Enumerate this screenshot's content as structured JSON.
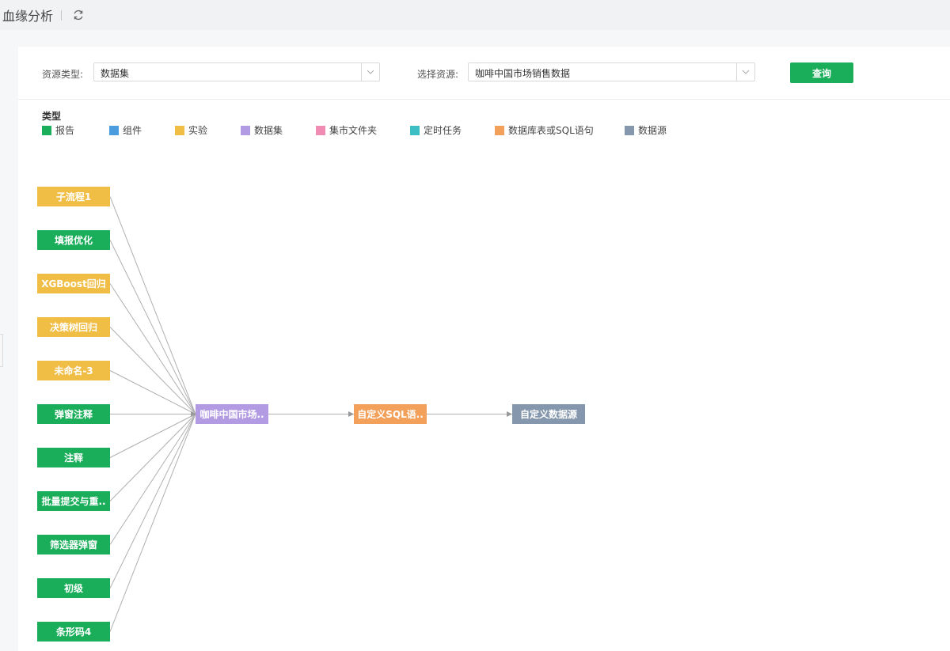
{
  "header": {
    "title": "血缘分析"
  },
  "filters": {
    "resource_type_label": "资源类型:",
    "resource_type_value": "数据集",
    "select_resource_label": "选择资源:",
    "select_resource_value": "咖啡中国市场销售数据",
    "query_label": "查询"
  },
  "legend": {
    "title": "类型",
    "items": [
      {
        "label": "报告",
        "color": "#1aad5a"
      },
      {
        "label": "组件",
        "color": "#4a9ee0"
      },
      {
        "label": "实验",
        "color": "#f0bd45"
      },
      {
        "label": "数据集",
        "color": "#b39be3"
      },
      {
        "label": "集市文件夹",
        "color": "#f08cb4"
      },
      {
        "label": "定时任务",
        "color": "#3dbdc4"
      },
      {
        "label": "数据库表或SQL语句",
        "color": "#f2a05a"
      },
      {
        "label": "数据源",
        "color": "#8497ad"
      }
    ]
  },
  "graph": {
    "left_nodes": [
      {
        "label": "子流程1",
        "color": "#f0bd45"
      },
      {
        "label": "填报优化",
        "color": "#1aad5a"
      },
      {
        "label": "XGBoost回归",
        "color": "#f0bd45"
      },
      {
        "label": "决策树回归",
        "color": "#f0bd45"
      },
      {
        "label": "未命名-3",
        "color": "#f0bd45"
      },
      {
        "label": "弹窗注释",
        "color": "#1aad5a"
      },
      {
        "label": "注释",
        "color": "#1aad5a"
      },
      {
        "label": "批量提交与重..",
        "color": "#1aad5a"
      },
      {
        "label": "筛选器弹窗",
        "color": "#1aad5a"
      },
      {
        "label": "初级",
        "color": "#1aad5a"
      },
      {
        "label": "条形码4",
        "color": "#1aad5a"
      }
    ],
    "chain_nodes": [
      {
        "label": "咖啡中国市场..",
        "color": "#b39be3"
      },
      {
        "label": "自定义SQL语..",
        "color": "#f2a05a"
      },
      {
        "label": "自定义数据源",
        "color": "#8497ad"
      }
    ],
    "edge_color": "#b0b0b0"
  }
}
